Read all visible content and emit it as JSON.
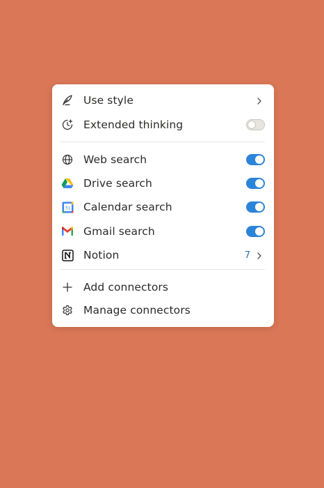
{
  "menu": {
    "items": [
      {
        "label": "Use style",
        "icon": "quill-icon",
        "control": "chevron"
      },
      {
        "label": "Extended thinking",
        "icon": "clock-plus-icon",
        "control": "toggle",
        "enabled": false
      },
      {
        "label": "Web search",
        "icon": "globe-icon",
        "control": "toggle",
        "enabled": true
      },
      {
        "label": "Drive search",
        "icon": "google-drive-icon",
        "control": "toggle",
        "enabled": true
      },
      {
        "label": "Calendar search",
        "icon": "google-calendar-icon",
        "control": "toggle",
        "enabled": true
      },
      {
        "label": "Gmail search",
        "icon": "gmail-icon",
        "control": "toggle",
        "enabled": true
      },
      {
        "label": "Notion",
        "icon": "notion-icon",
        "control": "chevron",
        "count": "7"
      },
      {
        "label": "Add connectors",
        "icon": "plus-icon"
      },
      {
        "label": "Manage connectors",
        "icon": "gear-icon"
      }
    ]
  },
  "colors": {
    "background": "#D97757",
    "toggle_on": "#2C84D8",
    "count_text": "#2A6BB8"
  }
}
